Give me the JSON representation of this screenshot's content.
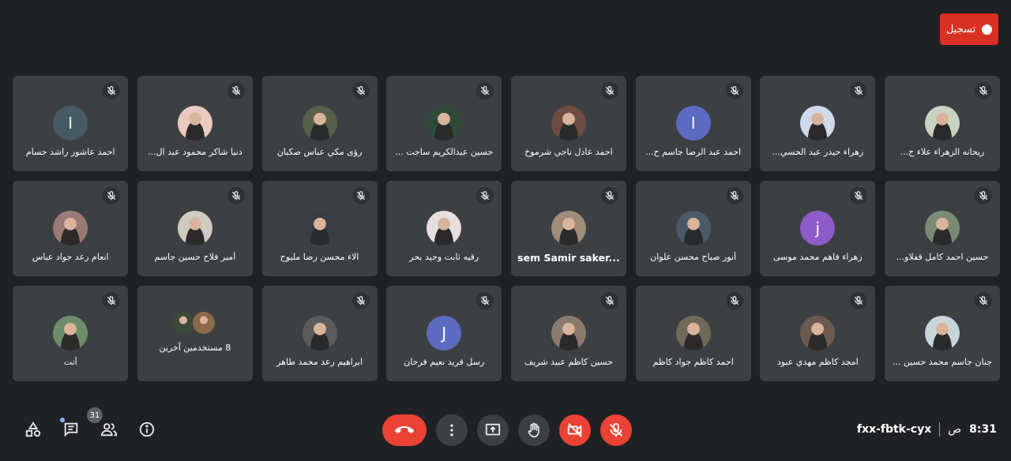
{
  "record": {
    "label": "تسجيل"
  },
  "participants": [
    {
      "name": "ريحانه الزهراء علاء ح...",
      "avatar_color": "#c9d3c1"
    },
    {
      "name": "زهراء حيدر عبد الحسي...",
      "avatar_color": "#cfd9ea"
    },
    {
      "name": "احمد عبد الرضا جاسم ح...",
      "initial": "ا",
      "avatar_color": "#5c6bc0"
    },
    {
      "name": "احمد عادل ناجي شرموخ",
      "avatar_color": "#6d4c41"
    },
    {
      "name": "حسين عبدالكريم ساجت ...",
      "avatar_color": "#2e4a3a"
    },
    {
      "name": "رؤى مكي عباس صكبان",
      "avatar_color": "#56604a"
    },
    {
      "name": "دنيا شاكر محمود عبد ال...",
      "avatar_color": "#e9c9c0"
    },
    {
      "name": "احمد عاشور راشد جسام",
      "initial": "ا",
      "avatar_color": "#455a64"
    },
    {
      "name": "حسين احمد كامل قفلاو...",
      "avatar_color": "#7a8b74"
    },
    {
      "name": "زهراء فاهم محمد موسى",
      "initial": "j",
      "avatar_color": "#8e5cc9"
    },
    {
      "name": "أنور صباح محسن علوان",
      "avatar_color": "#4b5a66"
    },
    {
      "name": "sem Samir saker...",
      "ltr": true,
      "avatar_color": "#a08d78"
    },
    {
      "name": "رقيه ثابت وحيد بحر",
      "avatar_color": "#e6dfe0"
    },
    {
      "name": "الاء محسن رضا مليوح",
      "avatar_color": "#3b3b44"
    },
    {
      "name": "أمير فلاح حسين جاسم",
      "avatar_color": "#cfcac2"
    },
    {
      "name": "انعام رعد جواد عباس",
      "avatar_color": "#9a7b73"
    },
    {
      "name": "جنان جاسم محمد حسين ...",
      "avatar_color": "#c7d6da"
    },
    {
      "name": "امجد كاظم مهدي عبود",
      "avatar_color": "#6b5a50"
    },
    {
      "name": "احمد كاظم جواد كاظم",
      "avatar_color": "#6f6a58"
    },
    {
      "name": "حسين كاظم عبيد شريف",
      "avatar_color": "#8c7b6d"
    },
    {
      "name": "رسل فريد نعيم فرحان",
      "initial": "J",
      "avatar_color": "#5c6bc0"
    },
    {
      "name": "ابراهيم رعد محمد طاهر",
      "avatar_color": "#5c5c5c"
    },
    {
      "name": "أنت",
      "avatar_color": "#6d8d6a"
    }
  ],
  "others": {
    "label": "8 مستخدمين آخرين",
    "colors": [
      "#3a4a3a",
      "#8a6a4a"
    ]
  },
  "toolbar": {
    "people_count": "31",
    "activities_icon": "shapes-icon",
    "chat_icon": "chat-icon",
    "people_icon": "people-icon",
    "info_icon": "info-icon",
    "end_call_icon": "call-end-icon",
    "more_icon": "more-vert-icon",
    "present_icon": "present-icon",
    "hand_icon": "raise-hand-icon",
    "camera_icon": "camera-off-icon",
    "mic_icon": "mic-off-icon"
  },
  "meeting": {
    "code": "fxx-fbtk-cyx",
    "time": "8:31",
    "ampm": "ص"
  }
}
